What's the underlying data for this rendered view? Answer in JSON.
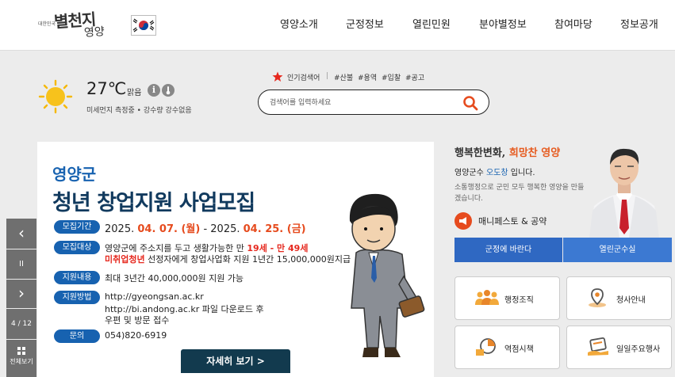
{
  "header": {
    "logo_small": "대한민국",
    "logo_main": "별천지",
    "logo_sub": "영양",
    "nav": [
      "영양소개",
      "군정정보",
      "열린민원",
      "분야별정보",
      "참여마당",
      "정보공개"
    ]
  },
  "weather": {
    "temperature": "27℃",
    "sky": "맑음",
    "info_i": "i",
    "detail": "미세먼지 측정중 • 강수량 강수없음"
  },
  "search": {
    "popular_label": "인기검색어",
    "separator": "|",
    "tags": [
      "#산불",
      "#용역",
      "#입찰",
      "#공고"
    ],
    "placeholder": "검색어를 입력하세요"
  },
  "banner": {
    "county": "영양군",
    "title": "청년 창업지원 사업모집",
    "rows": [
      {
        "label": "모집기간"
      },
      {
        "label": "모집대상",
        "line1_pre": "영양군에 주소지를 두고 생활가능한 만 ",
        "line1_red": "19세 - 만 49세",
        "line2_red": "미취업청년",
        "line2_post": " 선정자에게 창업사업화 지원 1년간 15,000,000원지급"
      },
      {
        "label": "지원내용",
        "text": "최대 3년간 40,000,000원 지원 가능"
      },
      {
        "label": "지원방법",
        "lines": [
          "http://gyeongsan.ac.kr",
          "http://bi.andong.ac.kr 파일 다운로드 후",
          "우편 및 방문 접수"
        ]
      },
      {
        "label": "문의",
        "text": "054)820-6919"
      }
    ],
    "date_pre": "2025. ",
    "date_start": "04. 07. (월)",
    "date_mid": " - 2025. ",
    "date_end": "04. 25. (금)",
    "more_button": "자세히 보기 >"
  },
  "slider": {
    "prev": "‹",
    "pause": "II",
    "next": "›",
    "counter": "4 / 12",
    "view_all": "전체보기"
  },
  "mayor": {
    "slogan_pre": "행복한변화, ",
    "slogan_em": "희망찬 영양",
    "name_pre": "영양군수 ",
    "name": "오도창",
    "name_post": " 입니다.",
    "desc": "소통행정으로 군민 모두 행복한 영양을 만들겠습니다.",
    "manifesto": "매니페스토 & 공약",
    "btn_left": "군정에 바란다",
    "btn_right": "열린군수실"
  },
  "quick_links": [
    "행정조직",
    "청사안내",
    "역점시책",
    "일일주요행사"
  ],
  "colors": {
    "accent_blue": "#1762b0",
    "accent_orange": "#e64b1e",
    "button_blue": "#2f68c2",
    "dark_navy": "#123a4e"
  }
}
